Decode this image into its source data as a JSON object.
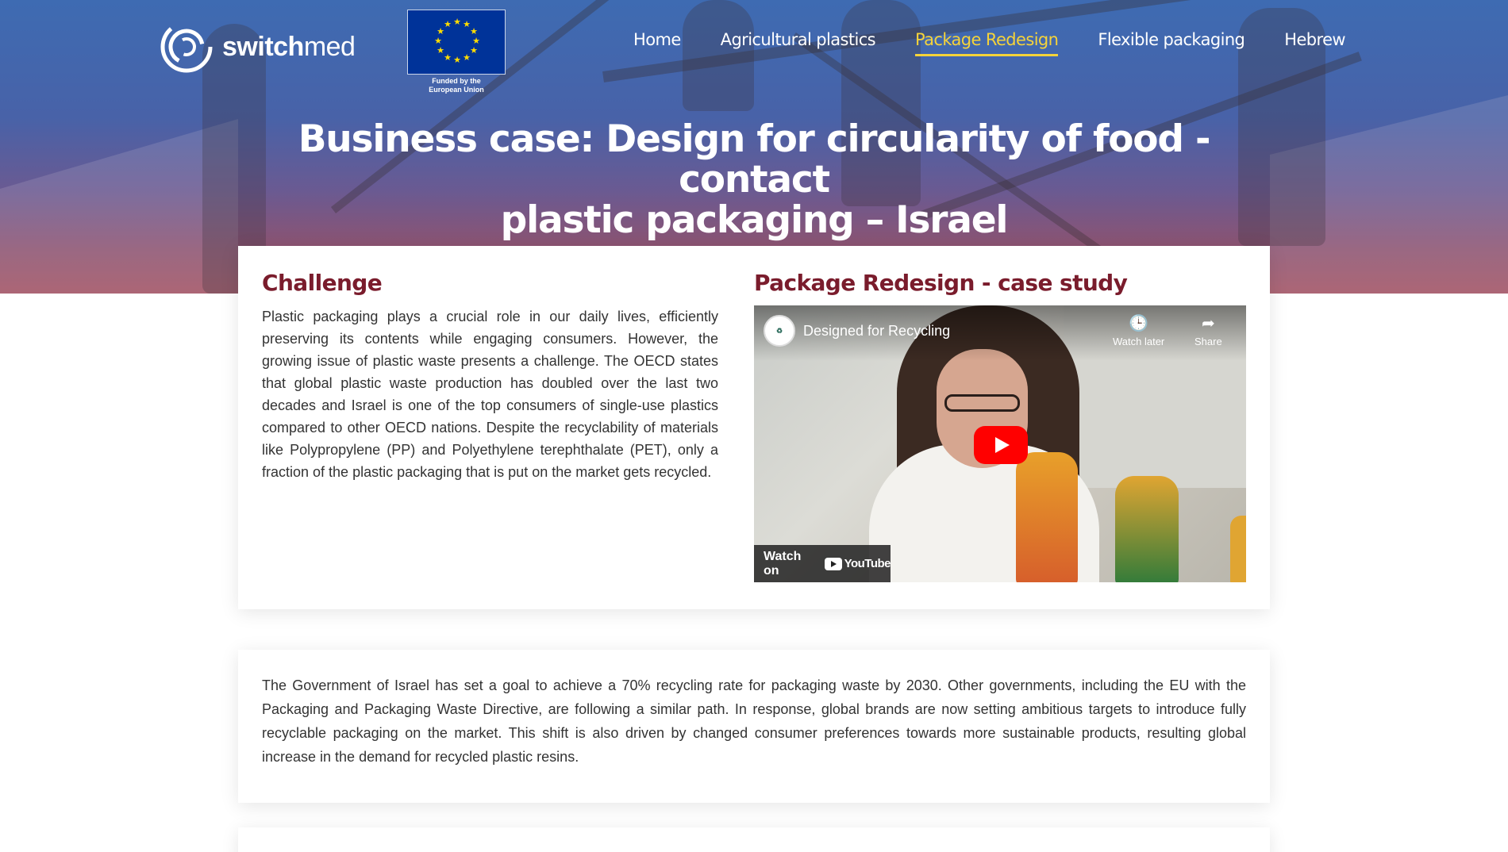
{
  "brand": {
    "logo_text_bold": "swi",
    "logo_text_bold2": "tch",
    "logo_text_light": "med",
    "eu_caption_line1": "Funded by the",
    "eu_caption_line2": "European Union"
  },
  "nav": {
    "items": [
      {
        "label": "Home",
        "active": false
      },
      {
        "label": "Agricultural plastics",
        "active": false
      },
      {
        "label": "Package Redesign",
        "active": true
      },
      {
        "label": "Flexible packaging",
        "active": false
      },
      {
        "label": "Hebrew",
        "active": false
      }
    ]
  },
  "hero": {
    "title_line1": "Business case: Design for circularity of food - contact",
    "title_line2": "plastic packaging – Israel"
  },
  "challenge": {
    "title": "Challenge",
    "body": "Plastic packaging plays a crucial role in our daily lives, efficiently preserving its contents while engaging consumers. However, the growing issue of plastic waste presents a challenge. The OECD states that global plastic waste production has doubled over the last two decades and Israel is one of the top consumers of single-use plastics compared to other OECD nations. Despite the recyclability of materials like Polypropylene (PP) and Polyethylene terephthalate (PET), only a fraction of the plastic packaging that is put on the market gets recycled."
  },
  "case_study": {
    "title": "Package Redesign - case study",
    "video": {
      "title": "Designed for Recycling",
      "watch_later": "Watch later",
      "share": "Share",
      "watch_on": "Watch on",
      "youtube": "YouTube"
    }
  },
  "goal": {
    "body": "The Government of Israel has set a goal to achieve a 70% recycling rate for packaging waste by 2030. Other governments, including the EU with the Packaging and Packaging Waste Directive, are following a similar path. In response, global brands are now setting ambitious targets to introduce fully recyclable packaging on the market. This shift is also driven by changed consumer preferences towards more sustainable products, resulting global increase in the demand for recycled plastic resins."
  },
  "colors": {
    "accent_yellow": "#f5d33a",
    "heading_maroon": "#7a1c2c",
    "eu_blue": "#003399",
    "youtube_red": "#ff0000"
  }
}
